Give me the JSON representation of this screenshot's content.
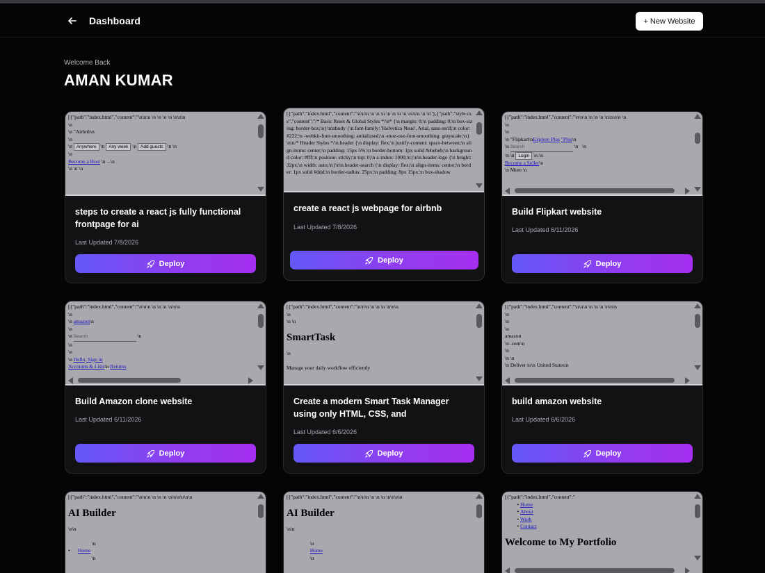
{
  "header": {
    "title": "Dashboard",
    "new_website_label": "+ New Website"
  },
  "welcome": {
    "greeting": "Welcome Back",
    "name": "AMAN KUMAR"
  },
  "deploy_label": "Deploy",
  "cards": [
    {
      "title": "steps to create a react js fully functional frontpage for ai",
      "updated": "Last Updated 7/8/2026",
      "preview": {
        "line1": "[{\"path\":\"index.html\",\"content\":\"\\n\\n\\n \\n \\n \\n \\n \\n\\n\\n",
        "line2": "\\n",
        "line3": "\\n \"Airbnb\\n",
        "line4": "\\n",
        "line5": "\\n",
        "box1": "Anywhere",
        "box2": "Any week",
        "box3": "Add guests",
        "link1": "Become a Host",
        "line6": "\\n \\n \\n"
      }
    },
    {
      "title": "create a react js webpage for airbnb",
      "updated": "Last Updated 7/8/2026",
      "preview": {
        "text": "[{\"path\":\"index.html\",\"content\":\"\\n\\n\\n \\n \\n \\n \\n \\n \\n \\n \\n\\n\\n \\n \\n\"},{\"path\":\"style.css\",\"content\":\"/* Basic Reset & Global Styles */\\n* {\\n margin: 0;\\n padding: 0;\\n box-sizing: border-box;\\n}\\n\\nbody {\\n font-family: 'Helvetica Neue', Arial, sans-serif;\\n color: #222;\\n -webkit-font-smoothing: antialiased;\\n -moz-osx-font-smoothing: grayscale;\\n}\\n\\n/* Header Styles */\\n.header {\\n display: flex;\\n justify-content: space-between;\\n align-items: center;\\n padding: 15px 5%;\\n border-bottom: 1px solid #ebebeb;\\n background-color: #fff;\\n position: sticky;\\n top: 0;\\n z-index: 1000;\\n}\\n\\n.header-logo {\\n height: 32px;\\n width: auto;\\n}\\n\\n.header-search {\\n display: flex;\\n align-items: center;\\n border: 1px solid #ddd;\\n border-radius: 25px;\\n padding: 8px 15px;\\n box-shadow"
      }
    },
    {
      "title": "Build Flipkart website",
      "updated": "Last Updated 6/11/2026",
      "preview": {
        "line1": "[{\"path\":\"index.html\",\"content\":\"\\n\\n\\n \\n \\n \\n \\n\\n\\n\\n \\n",
        "line2": "\\n",
        "line3": "\\n",
        "line4": "\\n \"Flipkart\\n",
        "link1": "Explore Plus",
        "link2": "\"Plus",
        "input": "Search",
        "box1": "Login",
        "link3": "Become a Seller",
        "line5": "\\n More \\n"
      }
    },
    {
      "title": "Build Amazon clone website",
      "updated": "Last Updated 6/11/2026",
      "preview": {
        "line1": "[{\"path\":\"index.html\",\"content\":\"\\n\\n\\n \\n \\n \\n \\n\\n\\n",
        "line2": "\\n",
        "link1": "amazon",
        "line3": "\\n",
        "input": "Search",
        "link2": "Hello, Sign in",
        "link3": "Accounts & Lists",
        "link4": "Returns"
      }
    },
    {
      "title": "Create a modern Smart Task Manager using only HTML, CSS, and",
      "updated": "Last Updated 6/6/2026",
      "preview": {
        "line1": "[{\"path\":\"index.html\",\"content\":\"\\n\\n\\n \\n \\n \\n \\n\\n\\n",
        "line2": "\\n",
        "line3": "\\n \\n",
        "heading": "SmartTask",
        "line4": "\\n",
        "line5": "Manage your daily workflow efficiently"
      }
    },
    {
      "title": "build amazon website",
      "updated": "Last Updated 6/6/2026",
      "preview": {
        "line1": "[{\"path\":\"index.html\",\"content\":\"\\n\\n\\n \\n \\n \\n \\n\\n\\n",
        "line2": "\\n",
        "line3": "\\n",
        "line4": "amazon",
        "line5": "\\n .com\\n",
        "line6": "\\n \\n",
        "line7": "\\n Deliver to\\n United States\\n"
      }
    },
    {
      "title": "",
      "updated": "",
      "preview": {
        "line1": "[{\"path\":\"index.html\",\"content\":\"\\n\\n\\n \\n \\n \\n \\n\\n\\n\\n\\n\\n",
        "heading": "AI Builder",
        "line2": "\\n\\n",
        "link1": "Home"
      }
    },
    {
      "title": "",
      "updated": "",
      "preview": {
        "line1": "[{\"path\":\"index.html\",\"content\":\"\\n\\n\\n \\n \\n \\n \\n\\n\\n\\n",
        "heading": "AI Builder",
        "line2": "\\n\\n",
        "link1": "Home"
      }
    },
    {
      "title": "",
      "updated": "",
      "preview": {
        "line1": "[{\"path\":\"index.html\",\"content\":\"",
        "link1": "Home",
        "link2": "About",
        "link3": "Work",
        "link4": "Contact",
        "heading": "Welcome to My Portfolio"
      }
    }
  ]
}
